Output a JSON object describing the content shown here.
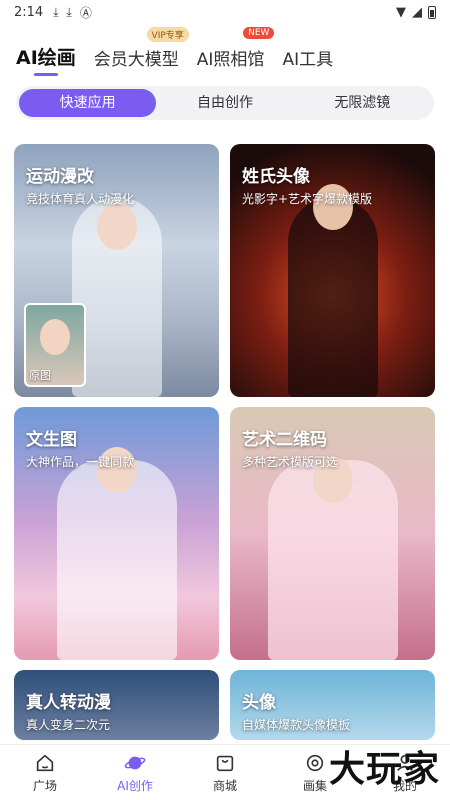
{
  "status": {
    "time": "2:14",
    "icons": [
      "download-icon",
      "download-icon",
      "app-a-icon"
    ]
  },
  "top_tabs": [
    {
      "label": "AI绘画",
      "active": true
    },
    {
      "label": "会员大模型",
      "tag": "VIP专享"
    },
    {
      "label": "AI照相馆",
      "tag": "NEW"
    },
    {
      "label": "AI工具"
    }
  ],
  "segments": [
    {
      "label": "快速应用",
      "active": true
    },
    {
      "label": "自由创作"
    },
    {
      "label": "无限滤镜"
    }
  ],
  "cards": [
    {
      "title": "运动漫改",
      "subtitle": "竞技体育真人动漫化",
      "thumb_label": "原图"
    },
    {
      "title": "姓氏头像",
      "subtitle": "光影字+艺术字爆款模版"
    },
    {
      "title": "文生图",
      "subtitle": "大神作品，一键同款"
    },
    {
      "title": "艺术二维码",
      "subtitle": "多种艺术模版可选"
    },
    {
      "title": "真人转动漫",
      "subtitle": "真人变身二次元"
    },
    {
      "title": "头像",
      "subtitle": "自媒体爆款头像模板"
    }
  ],
  "bottom_nav": [
    {
      "label": "广场",
      "icon": "home-icon"
    },
    {
      "label": "AI创作",
      "icon": "planet-icon",
      "active": true
    },
    {
      "label": "商城",
      "icon": "shop-bag-icon"
    },
    {
      "label": "画集",
      "icon": "gallery-icon"
    },
    {
      "label": "我的",
      "icon": "profile-icon"
    }
  ],
  "watermark": "大玩家",
  "colors": {
    "accent": "#7b5cf0",
    "new_tag": "#f04a3a",
    "vip_tag": "#f7d9a1"
  }
}
